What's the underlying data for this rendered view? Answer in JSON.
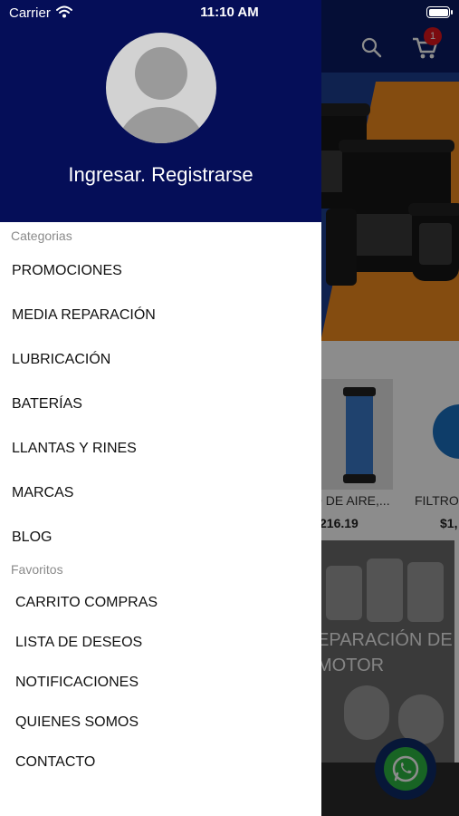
{
  "status_bar": {
    "carrier": "Carrier",
    "time": "11:10 AM"
  },
  "header": {
    "cart_badge": "1"
  },
  "drawer": {
    "login_text": "Ingresar. Registrarse",
    "categories_label": "Categorias",
    "categories": [
      "PROMOCIONES",
      "MEDIA REPARACIÓN",
      "LUBRICACIÓN",
      "BATERÍAS",
      "LLANTAS Y RINES",
      "MARCAS",
      "BLOG"
    ],
    "favorites_label": "Favoritos",
    "favorites": [
      "CARRITO COMPRAS",
      "LISTA DE DESEOS",
      "NOTIFICACIONES",
      "QUIENES SOMOS",
      "CONTACTO"
    ]
  },
  "products": [
    {
      "name": "O DE AIRE,...",
      "price": "216.19"
    },
    {
      "name": "FILTRO",
      "price": "$1,"
    }
  ],
  "promo_banner_text": "EPARACIÓN DE MOTOR",
  "colors": {
    "drawer_header": "#050e58",
    "app_header": "#0a1a63",
    "badge": "#e0141c",
    "whatsapp": "#2db742"
  },
  "icons": [
    "search-icon",
    "cart-icon",
    "wifi-icon",
    "battery-icon",
    "avatar-placeholder-icon",
    "whatsapp-icon"
  ]
}
